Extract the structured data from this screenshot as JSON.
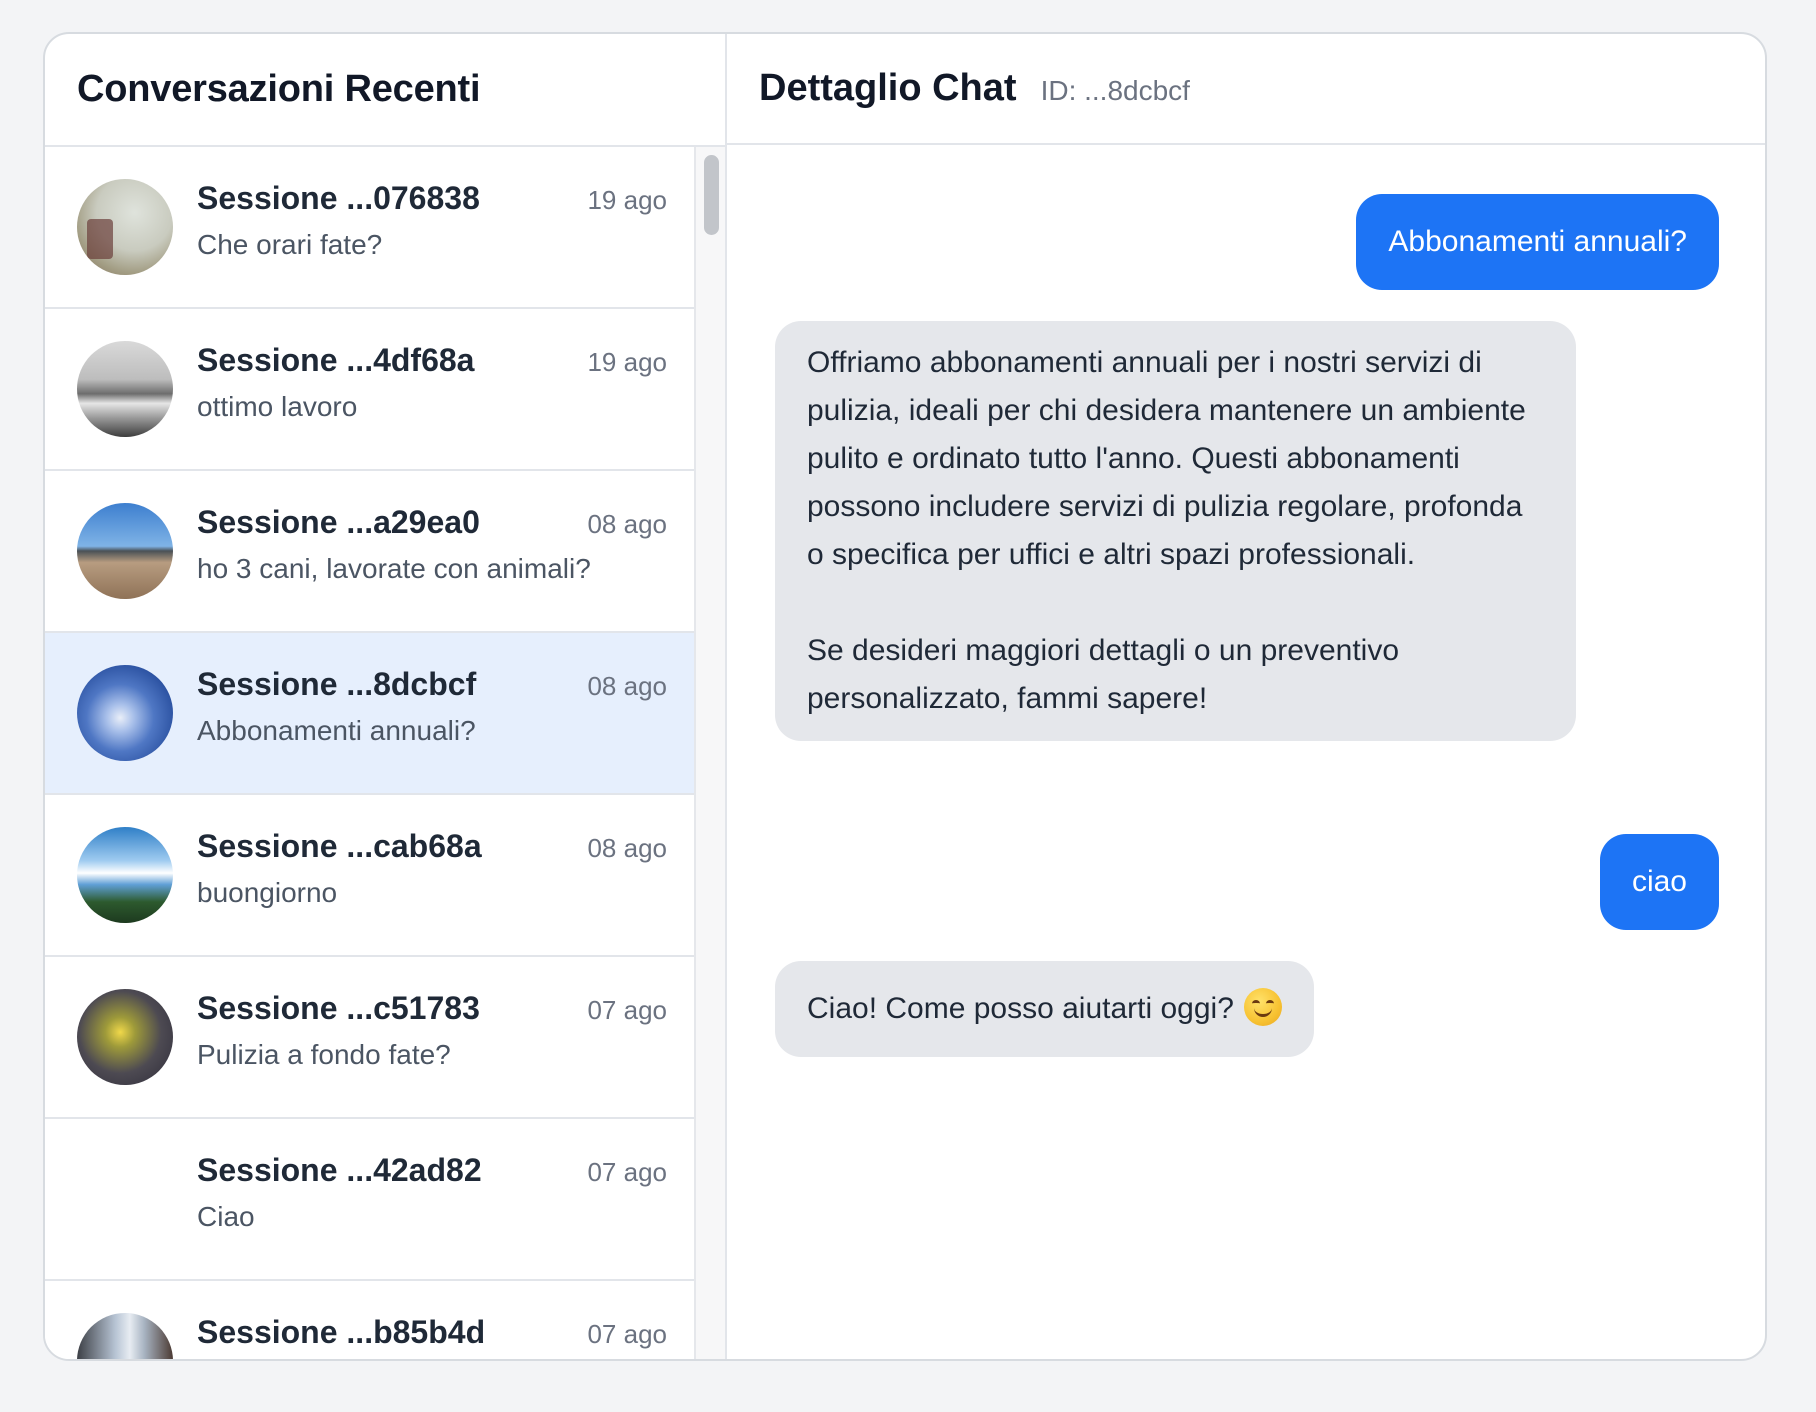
{
  "sidebar": {
    "title": "Conversazioni Recenti",
    "items": [
      {
        "name": "Sessione ...076838",
        "date": "19 ago",
        "preview": "Che orari fate?",
        "avatar": "photo-seaside-avatar",
        "active": false
      },
      {
        "name": "Sessione ...4df68a",
        "date": "19 ago",
        "preview": "ottimo lavoro",
        "avatar": "photo-bw-landscape-avatar",
        "active": false
      },
      {
        "name": "Sessione ...a29ea0",
        "date": "08 ago",
        "preview": "ho 3 cani, lavorate con animali?",
        "avatar": "photo-beach-avatar",
        "active": false
      },
      {
        "name": "Sessione ...8dcbcf",
        "date": "08 ago",
        "preview": "Abbonamenti annuali?",
        "avatar": "photo-blue-abstract-avatar",
        "active": true
      },
      {
        "name": "Sessione ...cab68a",
        "date": "08 ago",
        "preview": "buongiorno",
        "avatar": "photo-sky-clouds-avatar",
        "active": false
      },
      {
        "name": "Sessione ...c51783",
        "date": "07 ago",
        "preview": "Pulizia a fondo fate?",
        "avatar": "photo-flower-avatar",
        "active": false
      },
      {
        "name": "Sessione ...42ad82",
        "date": "07 ago",
        "preview": "Ciao",
        "avatar": "none",
        "active": false
      },
      {
        "name": "Sessione ...b85b4d",
        "date": "07 ago",
        "preview": "",
        "avatar": "photo-street-avatar",
        "active": false
      }
    ]
  },
  "chat": {
    "title": "Dettaglio Chat",
    "id_label": "ID: ...8dcbcf",
    "messages": [
      {
        "role": "user",
        "text": "Abbonamenti annuali?"
      },
      {
        "role": "assistant",
        "text": "Offriamo abbonamenti annuali per i nostri servizi di pulizia, ideali per chi desidera mantenere un ambiente pulito e ordinato tutto l'anno. Questi abbonamenti possono includere servizi di pulizia regolare, profonda o specifica per uffici e altri spazi professionali.\n\nSe desideri maggiori dettagli o un preventivo personalizzato, fammi sapere!"
      },
      {
        "role": "user",
        "text": "ciao"
      },
      {
        "role": "assistant",
        "text": "Ciao! Come posso aiutarti oggi?",
        "emoji": "smiling-face-icon"
      }
    ]
  },
  "colors": {
    "user_bubble": "#1d74f5",
    "bot_bubble": "#e5e7eb",
    "active_item": "#e6effd"
  }
}
